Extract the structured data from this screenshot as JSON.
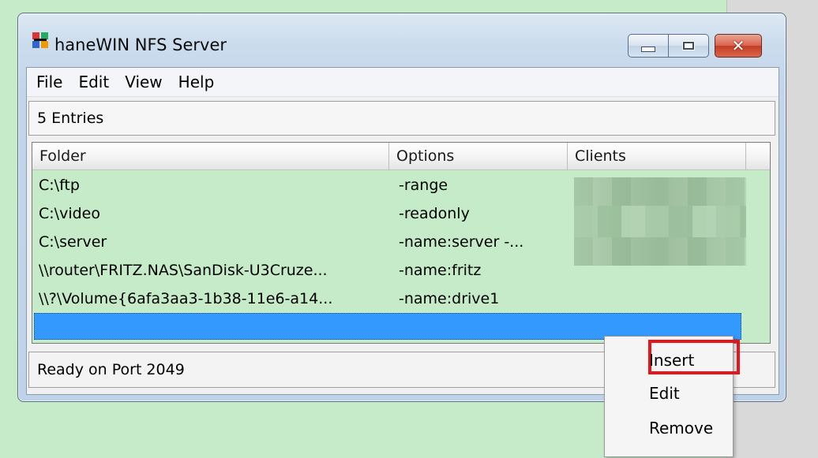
{
  "window": {
    "title": "haneWIN NFS Server",
    "close_glyph": "✕"
  },
  "menu": [
    "File",
    "Edit",
    "View",
    "Help"
  ],
  "entries_label": "5 Entries",
  "columns": [
    "Folder",
    "Options",
    "Clients"
  ],
  "rows": [
    {
      "folder": "C:\\ftp",
      "options": "-range"
    },
    {
      "folder": "C:\\video",
      "options": "-readonly"
    },
    {
      "folder": "C:\\server",
      "options": "-name:server -..."
    },
    {
      "folder": "\\\\router\\FRITZ.NAS\\SanDisk-U3Cruze...",
      "options": "-name:fritz"
    },
    {
      "folder": "\\\\?\\Volume{6afa3aa3-1b38-11e6-a14...",
      "options": "-name:drive1"
    }
  ],
  "status": "Ready on Port 2049",
  "context_menu": {
    "items": [
      "Insert",
      "Edit",
      "Remove"
    ]
  },
  "colors": {
    "background": "#c5ebc8",
    "selection": "#3399ff",
    "highlight": "#e8141b"
  }
}
